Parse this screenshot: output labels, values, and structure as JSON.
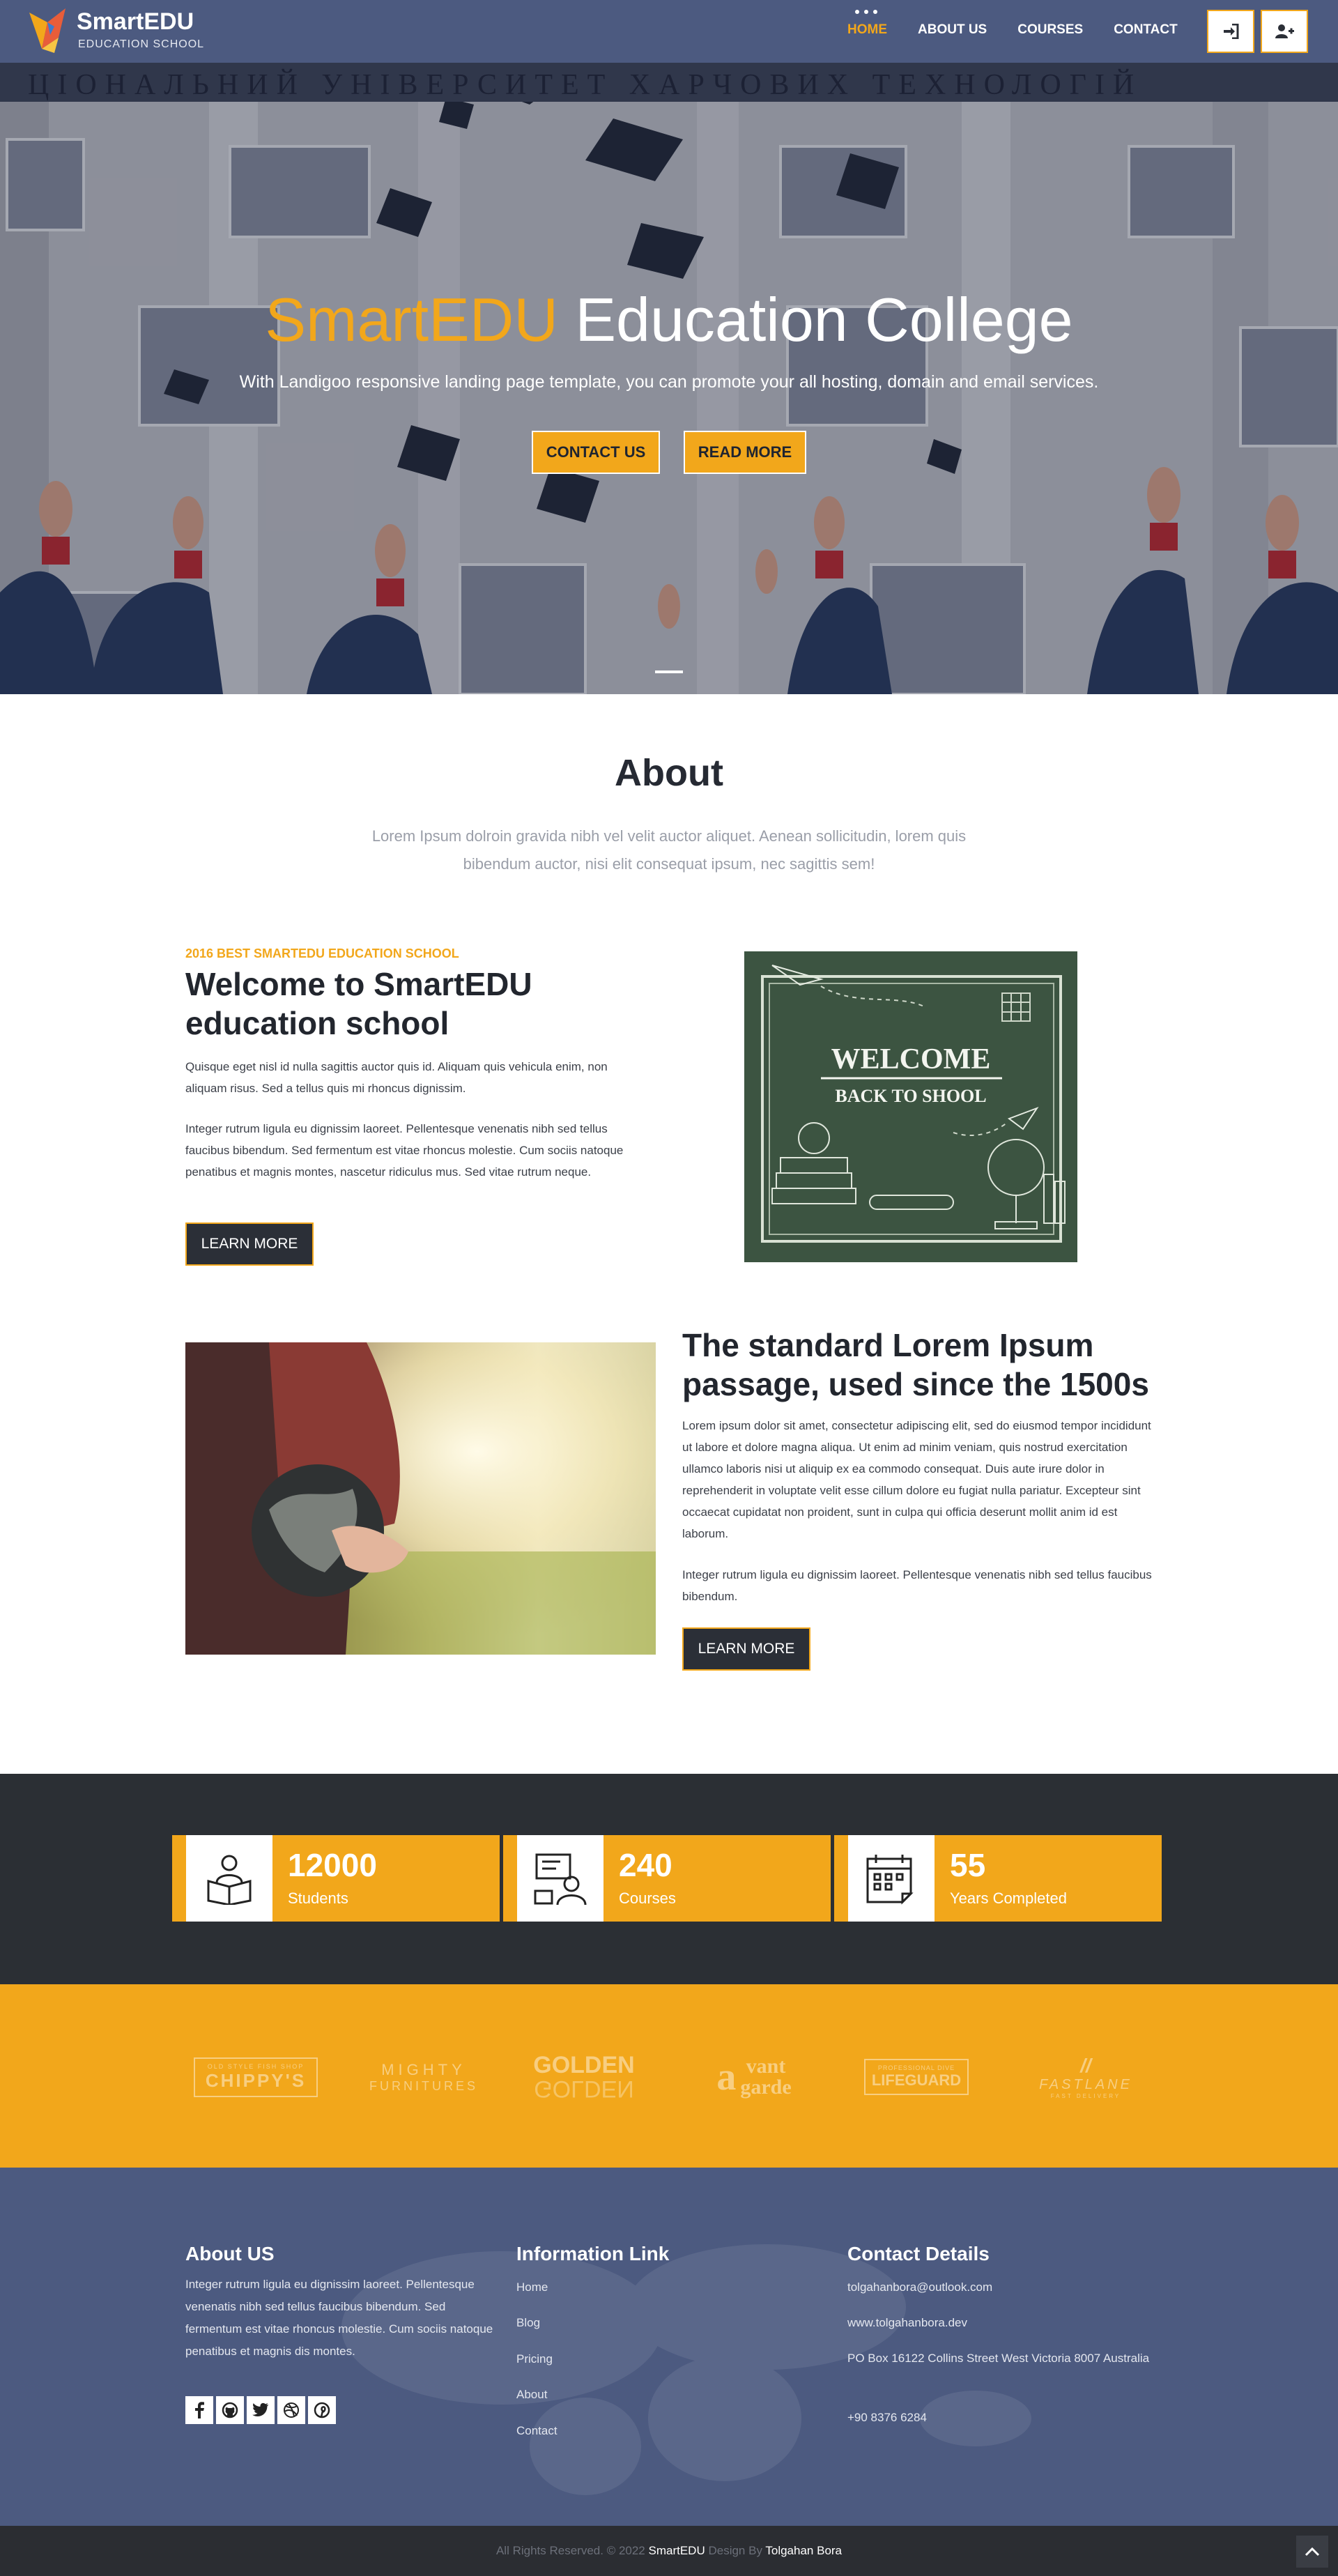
{
  "brand": {
    "name": "SmartEDU",
    "tagline": "EDUCATION SCHOOL"
  },
  "nav": {
    "items": [
      {
        "label": "HOME"
      },
      {
        "label": "ABOUT US"
      },
      {
        "label": "COURSES"
      },
      {
        "label": "CONTACT"
      }
    ],
    "login_icon": "sign-in-icon",
    "register_icon": "user-plus-icon"
  },
  "hero": {
    "title_accent": "SmartEDU",
    "title_rest": "Education College",
    "subtitle": "With Landigoo responsive landing page template, you can promote your all hosting, domain and email services.",
    "contact_label": "CONTACT US",
    "readmore_label": "READ MORE"
  },
  "about": {
    "title": "About",
    "description": "Lorem Ipsum dolroin gravida nibh vel velit auctor aliquet. Aenean sollicitudin, lorem quis bibendum auctor, nisi elit consequat ipsum, nec sagittis sem!",
    "kicker": "2016 BEST SMARTEDU EDUCATION SCHOOL",
    "welcome_title": "Welcome to SmartEDU education school",
    "welcome_p1": "Quisque eget nisl id nulla sagittis auctor quis id. Aliquam quis vehicula enim, non aliquam risus. Sed a tellus quis mi rhoncus dignissim.",
    "welcome_p2": "Integer rutrum ligula eu dignissim laoreet. Pellentesque venenatis nibh sed tellus faucibus bibendum. Sed fermentum est vitae rhoncus molestie. Cum sociis natoque penatibus et magnis montes, nascetur ridiculus mus. Sed vitae rutrum neque.",
    "learn_more": "LEARN MORE",
    "board_line1": "WELCOME",
    "board_line2": "BACK TO SHOOL",
    "standard_title": "The standard Lorem Ipsum passage, used since the 1500s",
    "standard_p1": "Lorem ipsum dolor sit amet, consectetur adipiscing elit, sed do eiusmod tempor incididunt ut labore et dolore magna aliqua. Ut enim ad minim veniam, quis nostrud exercitation ullamco laboris nisi ut aliquip ex ea commodo consequat. Duis aute irure dolor in reprehenderit in voluptate velit esse cillum dolore eu fugiat nulla pariatur. Excepteur sint occaecat cupidatat non proident, sunt in culpa qui officia deserunt mollit anim id est laborum.",
    "standard_p2": "Integer rutrum ligula eu dignissim laoreet. Pellentesque venenatis nibh sed tellus faucibus bibendum.",
    "learn_more_2": "LEARN MORE"
  },
  "stats": [
    {
      "value": "12000",
      "label": "Students",
      "icon": "student-reading-icon"
    },
    {
      "value": "240",
      "label": "Courses",
      "icon": "teacher-board-icon"
    },
    {
      "value": "55",
      "label": "Years Completed",
      "icon": "calendar-icon"
    }
  ],
  "partners": {
    "chippys": {
      "small": "OLD STYLE FISH SHOP",
      "main": "CHIPPY'S"
    },
    "mighty": {
      "line1": "MIGHTY",
      "line2": "FURNITURES"
    },
    "golden": {
      "line1": "GOLDEN",
      "line2": "GOLDEN"
    },
    "vant": {
      "line1": "vant",
      "line2": "garde"
    },
    "lifeguard": {
      "small": "PROFESSIONAL DIVE",
      "main": "LIFEGUARD"
    },
    "fastlane": {
      "main": "FASTLANE",
      "small": "FAST DELIVERY"
    }
  },
  "footer": {
    "about_title": "About US",
    "about_text": "Integer rutrum ligula eu dignissim laoreet. Pellentesque venenatis nibh sed tellus faucibus bibendum. Sed fermentum est vitae rhoncus molestie. Cum sociis natoque penatibus et magnis dis montes.",
    "social_icons": [
      "facebook-icon",
      "github-icon",
      "twitter-icon",
      "dribbble-icon",
      "pinterest-icon"
    ],
    "links_title": "Information Link",
    "links": [
      {
        "label": "Home"
      },
      {
        "label": "Blog"
      },
      {
        "label": "Pricing"
      },
      {
        "label": "About"
      },
      {
        "label": "Contact"
      }
    ],
    "contact_title": "Contact Details",
    "email": "tolgahanbora@outlook.com",
    "website": "www.tolgahanbora.dev",
    "address": "PO Box 16122 Collins Street West Victoria 8007 Australia",
    "phone": "+90 8376 6284"
  },
  "copyright": {
    "prefix": "All Rights Reserved. © 2022",
    "brand": "SmartEDU",
    "middle": "Design By",
    "author": "Tolgahan Bora"
  },
  "colors": {
    "accent": "#f2a71b",
    "nav": "#4c5a80",
    "dark": "#2b2f37"
  }
}
